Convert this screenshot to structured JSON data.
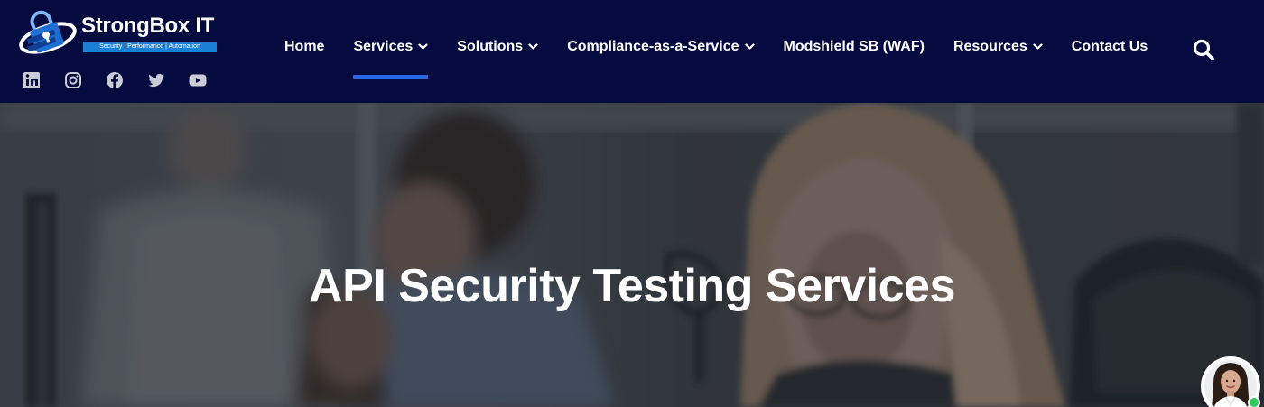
{
  "brand": {
    "name": "StrongBox IT",
    "tagline": "Security | Performance | Automation",
    "colors": {
      "header_bg": "#050b3e",
      "accent": "#2b66e8",
      "tagline_bg": "#1c7fd6"
    }
  },
  "social": [
    {
      "icon": "linkedin-icon"
    },
    {
      "icon": "instagram-icon"
    },
    {
      "icon": "facebook-icon"
    },
    {
      "icon": "twitter-icon"
    },
    {
      "icon": "youtube-icon"
    }
  ],
  "nav": {
    "items": [
      {
        "label": "Home",
        "has_dropdown": false,
        "active": false
      },
      {
        "label": "Services",
        "has_dropdown": true,
        "active": true
      },
      {
        "label": "Solutions",
        "has_dropdown": true,
        "active": false
      },
      {
        "label": "Compliance-as-a-Service",
        "has_dropdown": true,
        "active": false
      },
      {
        "label": "Modshield SB (WAF)",
        "has_dropdown": false,
        "active": false
      },
      {
        "label": "Resources",
        "has_dropdown": true,
        "active": false
      },
      {
        "label": "Contact Us",
        "has_dropdown": false,
        "active": false
      }
    ],
    "search_icon": "search-icon"
  },
  "hero": {
    "title": "API Security Testing Services"
  },
  "chat": {
    "avatar_icon": "support-agent-avatar",
    "status_color": "#2ecc5a"
  }
}
